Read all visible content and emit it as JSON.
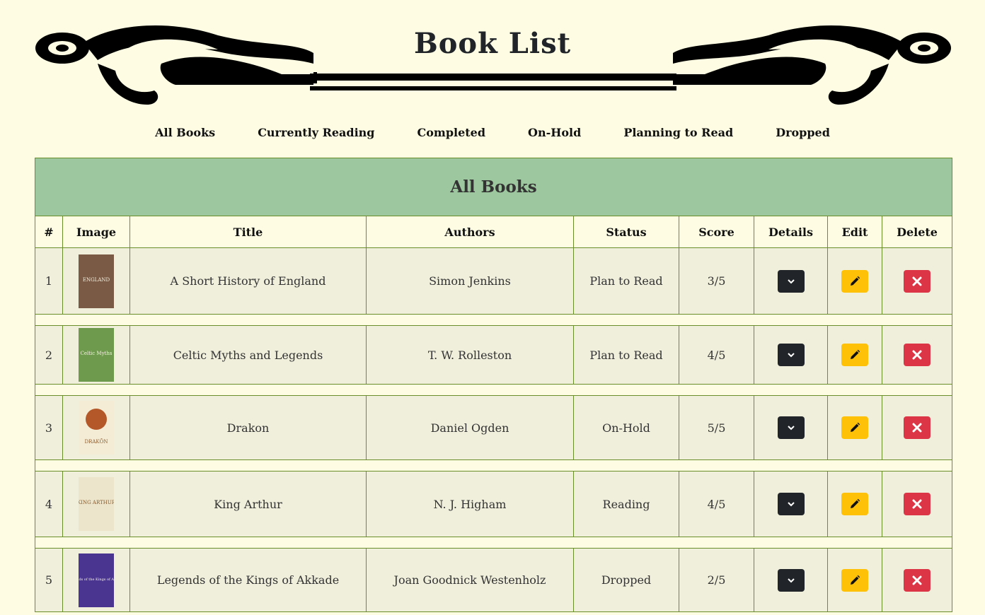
{
  "header": {
    "title": "Book List"
  },
  "nav": {
    "items": [
      {
        "label": "All Books",
        "name": "nav-all-books"
      },
      {
        "label": "Currently Reading",
        "name": "nav-currently-reading"
      },
      {
        "label": "Completed",
        "name": "nav-completed"
      },
      {
        "label": "On-Hold",
        "name": "nav-on-hold"
      },
      {
        "label": "Planning to Read",
        "name": "nav-planning-to-read"
      },
      {
        "label": "Dropped",
        "name": "nav-dropped"
      }
    ]
  },
  "table": {
    "caption": "All Books",
    "headers": {
      "num": "#",
      "image": "Image",
      "title": "Title",
      "authors": "Authors",
      "status": "Status",
      "score": "Score",
      "details": "Details",
      "edit": "Edit",
      "delete": "Delete"
    },
    "rows": [
      {
        "num": "1",
        "title": "A Short History of England",
        "authors": "Simon Jenkins",
        "status": "Plan to Read",
        "score": "3/5",
        "cover_color": "#7a5a44",
        "cover_text": "ENGLAND"
      },
      {
        "num": "2",
        "title": "Celtic Myths and Legends",
        "authors": "T. W. Rolleston",
        "status": "Plan to Read",
        "score": "4/5",
        "cover_color": "#6e9a4e",
        "cover_text": "Celtic Myths"
      },
      {
        "num": "3",
        "title": "Drakon",
        "authors": "Daniel Ogden",
        "status": "On-Hold",
        "score": "5/5",
        "cover_color": "#f5ecd6",
        "cover_text": "DRAKŌN"
      },
      {
        "num": "4",
        "title": "King Arthur",
        "authors": "N. J. Higham",
        "status": "Reading",
        "score": "4/5",
        "cover_color": "#ece5cc",
        "cover_text": "KING ARTHUR"
      },
      {
        "num": "5",
        "title": "Legends of the Kings of Akkade",
        "authors": "Joan Goodnick Westenholz",
        "status": "Dropped",
        "score": "2/5",
        "cover_color": "#4a3590",
        "cover_text": "Legends of the Kings of Akkade"
      }
    ]
  },
  "icons": {
    "details": "chevron-down-icon",
    "edit": "pencil-icon",
    "delete": "close-icon"
  },
  "colors": {
    "background": "#fefde3",
    "caption_bg": "#9dc79e",
    "row_bg": "#f0efdc",
    "border": "#6a8f2a",
    "details_btn": "#212529",
    "edit_btn": "#ffc107",
    "delete_btn": "#dc3545"
  }
}
